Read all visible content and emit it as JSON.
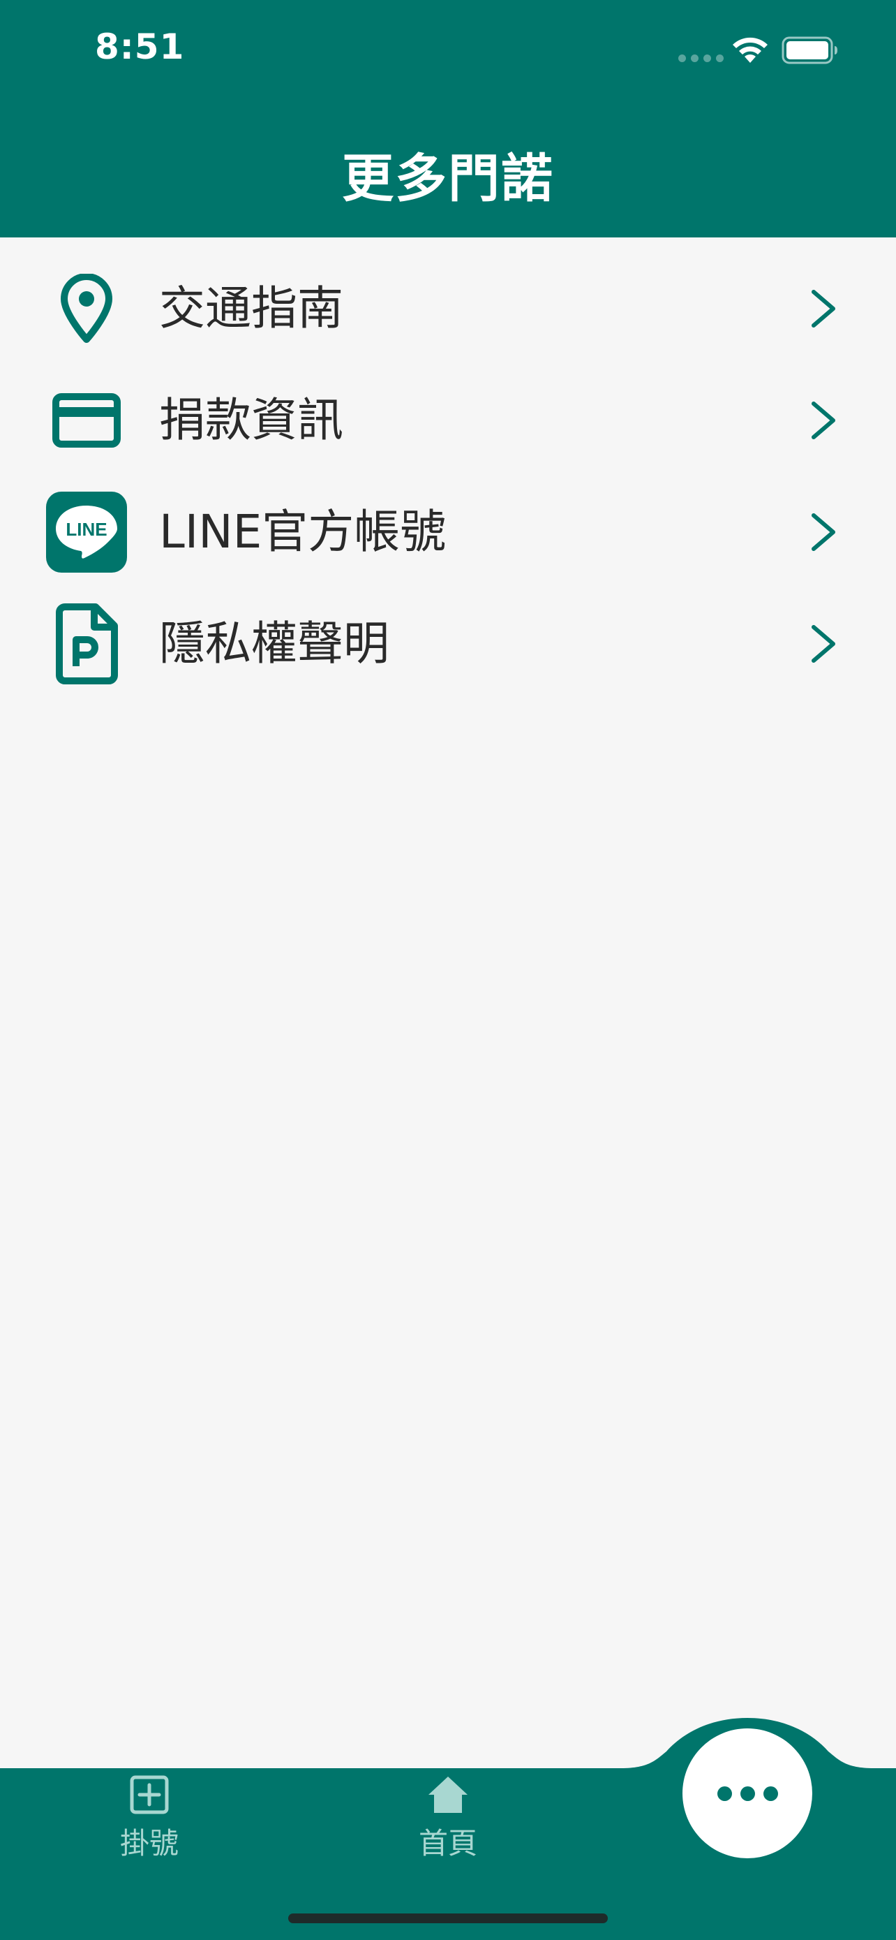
{
  "status_bar": {
    "time": "8:51"
  },
  "header": {
    "title": "更多門諾"
  },
  "menu": {
    "items": [
      {
        "label": "交通指南",
        "icon": "location-pin-icon"
      },
      {
        "label": "捐款資訊",
        "icon": "credit-card-icon"
      },
      {
        "label": "LINE官方帳號",
        "icon": "line-logo-icon",
        "logo_text": "LINE"
      },
      {
        "label": "隱私權聲明",
        "icon": "privacy-document-icon"
      }
    ]
  },
  "tabbar": {
    "tabs": [
      {
        "label": "掛號",
        "icon": "plus-square-icon"
      },
      {
        "label": "首頁",
        "icon": "home-icon"
      }
    ],
    "more_icon": "more-dots-icon"
  },
  "colors": {
    "brand": "#00756b",
    "background": "#f6f6f6",
    "text": "#2a2a2a",
    "tab_inactive": "#a8d7d1"
  }
}
